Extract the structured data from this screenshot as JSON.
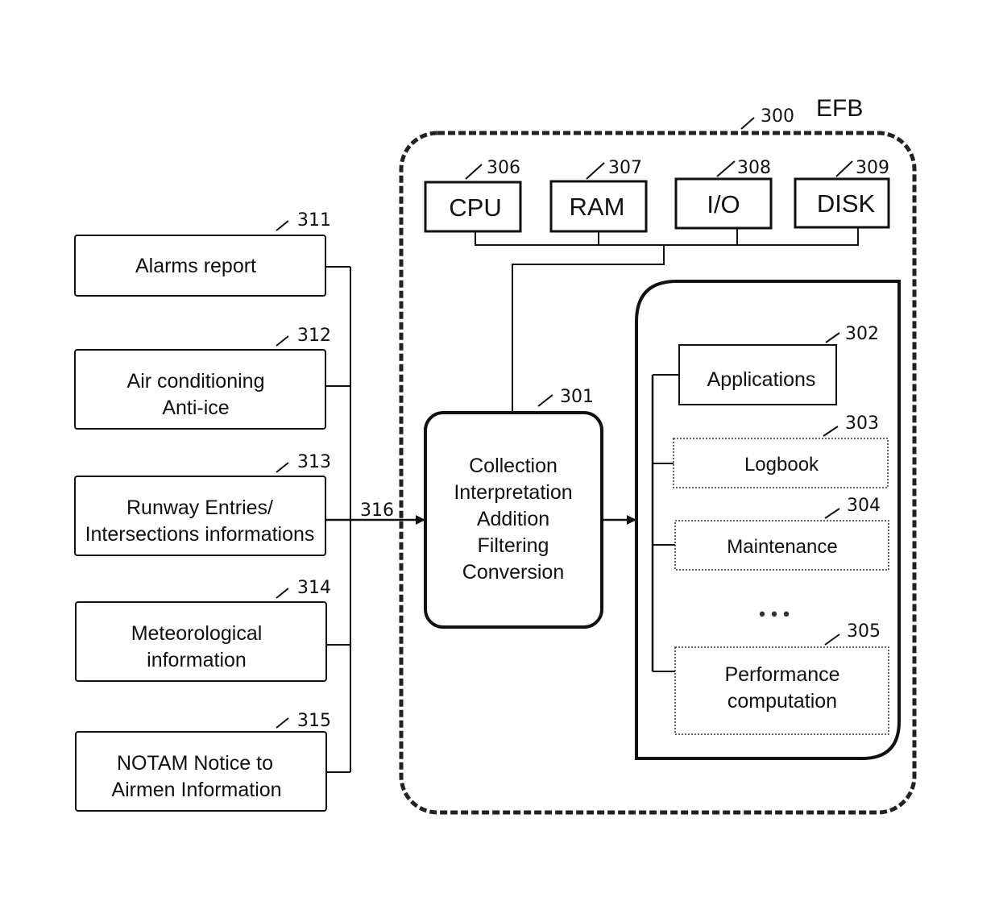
{
  "efb": {
    "label": "EFB",
    "ref": "300"
  },
  "hardware": [
    {
      "label": "CPU",
      "ref": "306"
    },
    {
      "label": "RAM",
      "ref": "307"
    },
    {
      "label": "I/O",
      "ref": "308"
    },
    {
      "label": "DISK",
      "ref": "309"
    }
  ],
  "processor": {
    "ref": "301",
    "lines": [
      "Collection",
      "Interpretation",
      "Addition",
      "Filtering",
      "Conversion"
    ]
  },
  "applications": {
    "main": {
      "label": "Applications",
      "ref": "302"
    },
    "items": [
      {
        "lines": [
          "Logbook"
        ],
        "ref": "303"
      },
      {
        "lines": [
          "Maintenance"
        ],
        "ref": "304"
      },
      {
        "lines": [
          "Performance",
          "computation"
        ],
        "ref": "305"
      }
    ],
    "ellipsis": "•••"
  },
  "sources": [
    {
      "lines": [
        "Alarms report"
      ],
      "ref": "311"
    },
    {
      "lines": [
        "Air conditioning",
        "Anti-ice"
      ],
      "ref": "312"
    },
    {
      "lines": [
        "Runway Entries/",
        "Intersections informations"
      ],
      "ref": "313"
    },
    {
      "lines": [
        "Meteorological",
        "information"
      ],
      "ref": "314"
    },
    {
      "lines": [
        "NOTAM Notice to",
        "Airmen Information"
      ],
      "ref": "315"
    }
  ],
  "bus": {
    "ref": "316"
  }
}
